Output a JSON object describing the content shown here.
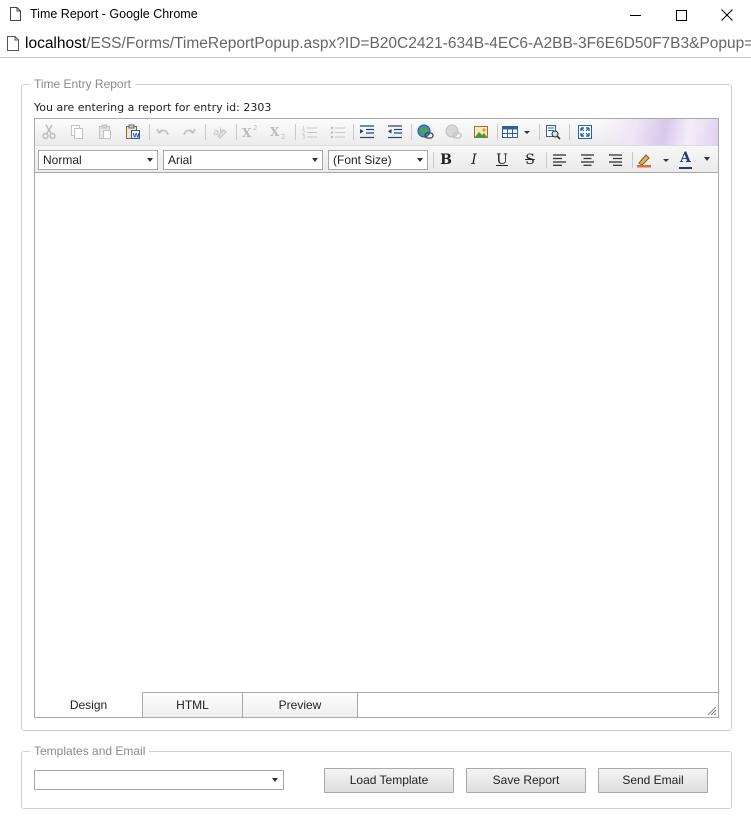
{
  "window": {
    "title": "Time Report - Google Chrome",
    "controls": [
      "minimize-icon",
      "maximize-icon",
      "close-icon"
    ]
  },
  "address": {
    "host": "localhost",
    "path": "/ESS/Forms/TimeReportPopup.aspx?ID=B20C2421-634B-4EC6-A2BB-3F6E6D50F7B3&Popup="
  },
  "time_entry": {
    "legend": "Time Entry Report",
    "entry_text": "You are entering a report for entry id: 2303"
  },
  "editor": {
    "toolbar1_icons": [
      "cut-icon",
      "copy-icon",
      "paste-icon",
      "paste-from-word-icon",
      "undo-icon",
      "redo-icon",
      "format-stripper-icon",
      "superscript-icon",
      "subscript-icon",
      "numbered-list-icon",
      "bulleted-list-icon",
      "indent-icon",
      "outdent-icon",
      "insert-link-icon",
      "remove-link-icon",
      "insert-image-icon",
      "insert-table-icon",
      "find-replace-icon",
      "fullscreen-icon"
    ],
    "paragraph_style": "Normal",
    "font_name": "Arial",
    "font_size": "(Font Size)",
    "format": {
      "bold": "B",
      "italic": "I",
      "underline": "U",
      "strike": "S",
      "forecolor": "A"
    },
    "tabs": [
      "Design",
      "HTML",
      "Preview"
    ],
    "active_tab": "Design"
  },
  "templates": {
    "legend": "Templates and Email",
    "selected_template": "",
    "load_label": "Load Template",
    "save_label": "Save Report",
    "send_label": "Send Email"
  }
}
